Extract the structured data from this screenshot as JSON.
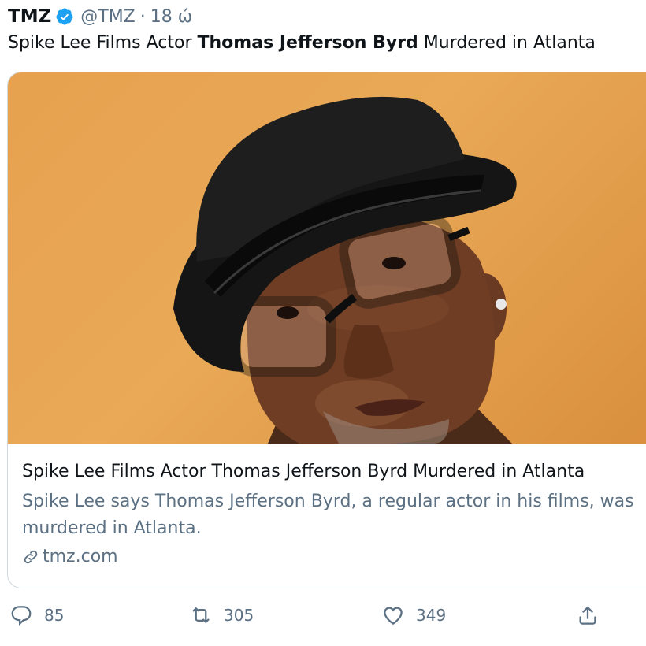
{
  "author": {
    "name": "TMZ",
    "handle": "@TMZ",
    "separator": "·",
    "time": "18 ώ"
  },
  "tweet": {
    "text_prefix": "Spike Lee Films Actor ",
    "text_bold": "Thomas Jefferson Byrd",
    "text_suffix": " Murdered in Atlanta"
  },
  "card": {
    "title": "Spike Lee Films Actor Thomas Jefferson Byrd Murdered in Atlanta",
    "description": "Spike Lee says Thomas Jefferson Byrd, a regular actor in his films, was murdered in Atlanta.",
    "domain": "tmz.com"
  },
  "actions": {
    "replies": "85",
    "retweets": "305",
    "likes": "349"
  },
  "colors": {
    "verified": "#1da1f2",
    "secondary_text": "#5b7083",
    "image_background": "#e7a14f"
  }
}
